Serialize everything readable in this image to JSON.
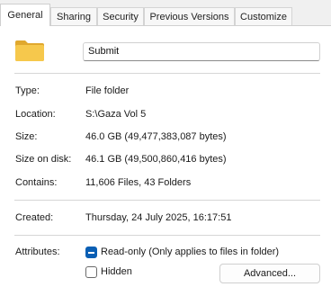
{
  "tabs": [
    {
      "label": "General",
      "active": true
    },
    {
      "label": "Sharing"
    },
    {
      "label": "Security"
    },
    {
      "label": "Previous Versions"
    },
    {
      "label": "Customize"
    }
  ],
  "folder_name": "Submit",
  "details": {
    "type_label": "Type:",
    "type_value": "File folder",
    "location_label": "Location:",
    "location_value": "S:\\Gaza Vol 5",
    "size_label": "Size:",
    "size_value": "46.0 GB (49,477,383,087 bytes)",
    "size_on_disk_label": "Size on disk:",
    "size_on_disk_value": "46.1 GB (49,500,860,416 bytes)",
    "contains_label": "Contains:",
    "contains_value": "11,606 Files, 43 Folders"
  },
  "created": {
    "label": "Created:",
    "value": "Thursday, 24 July 2025, 16:17:51"
  },
  "attributes": {
    "label": "Attributes:",
    "readonly_label": "Read-only (Only applies to files in folder)",
    "readonly_state": "indeterminate",
    "hidden_label": "Hidden",
    "hidden_checked": false,
    "advanced_label": "Advanced..."
  },
  "colors": {
    "accent": "#0a5fb4",
    "folder": "#f3c24a"
  }
}
